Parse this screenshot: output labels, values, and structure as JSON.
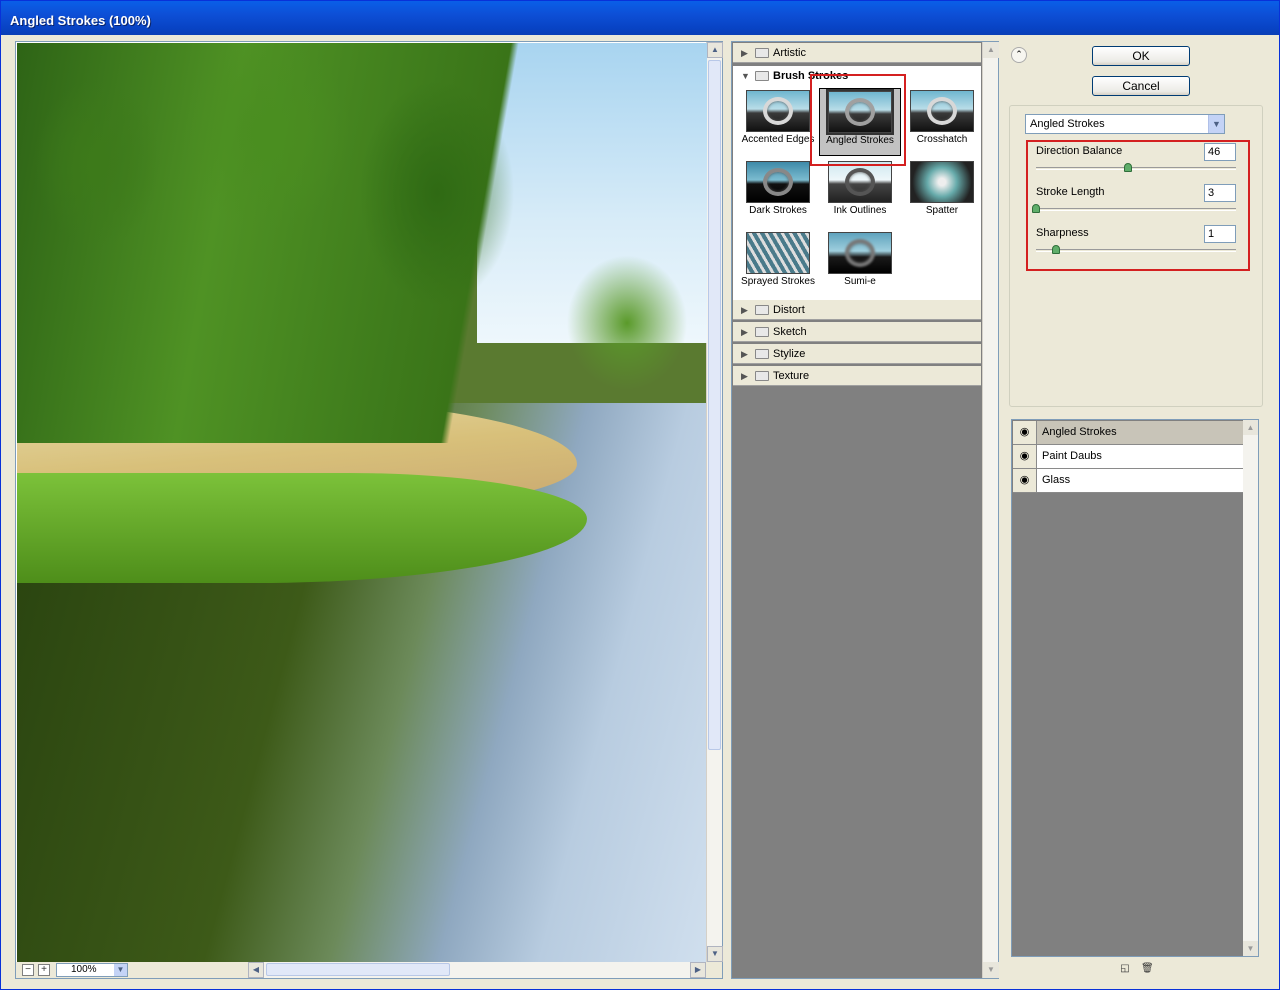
{
  "window": {
    "title": "Angled Strokes (100%)"
  },
  "preview": {
    "zoom_out": "−",
    "zoom_in": "+",
    "zoom_value": "100%",
    "scroll_up": "▲",
    "scroll_down": "▼",
    "scroll_left": "◀",
    "scroll_right": "▶",
    "dropdown_arrow": "▼"
  },
  "gallery": {
    "categories_top": [
      {
        "label": "Artistic",
        "expand": "▶"
      }
    ],
    "open_category": {
      "label": "Brush Strokes",
      "expand": "▼"
    },
    "thumbnails": [
      {
        "label": "Accented Edges"
      },
      {
        "label": "Angled Strokes",
        "selected": true
      },
      {
        "label": "Crosshatch"
      },
      {
        "label": "Dark Strokes"
      },
      {
        "label": "Ink Outlines"
      },
      {
        "label": "Spatter"
      },
      {
        "label": "Sprayed Strokes"
      },
      {
        "label": "Sumi-e"
      }
    ],
    "categories_bottom": [
      {
        "label": "Distort",
        "expand": "▶"
      },
      {
        "label": "Sketch",
        "expand": "▶"
      },
      {
        "label": "Stylize",
        "expand": "▶"
      },
      {
        "label": "Texture",
        "expand": "▶"
      }
    ],
    "scroll_up": "▲",
    "scroll_down": "▼"
  },
  "controls": {
    "collapse": "⌃",
    "ok_label": "OK",
    "cancel_label": "Cancel",
    "filter_select": "Angled Strokes",
    "dropdown_arrow": "▼"
  },
  "params": [
    {
      "label": "Direction Balance",
      "value": "46",
      "level": 0.46
    },
    {
      "label": "Stroke Length",
      "value": "3",
      "level": 0.0
    },
    {
      "label": "Sharpness",
      "value": "1",
      "level": 0.1
    }
  ],
  "layers": {
    "items": [
      {
        "name": "Angled Strokes",
        "active": true
      },
      {
        "name": "Paint Daubs",
        "active": false
      },
      {
        "name": "Glass",
        "active": false
      }
    ],
    "eye_glyph": "◉",
    "new_layer_glyph": "◱",
    "delete_glyph": "🗑",
    "scroll_up": "▲",
    "scroll_down": "▼"
  },
  "colors": {
    "title_bar": "#0a4fd6",
    "highlight_box": "#d42020",
    "dialog_bg": "#ece9d8"
  }
}
